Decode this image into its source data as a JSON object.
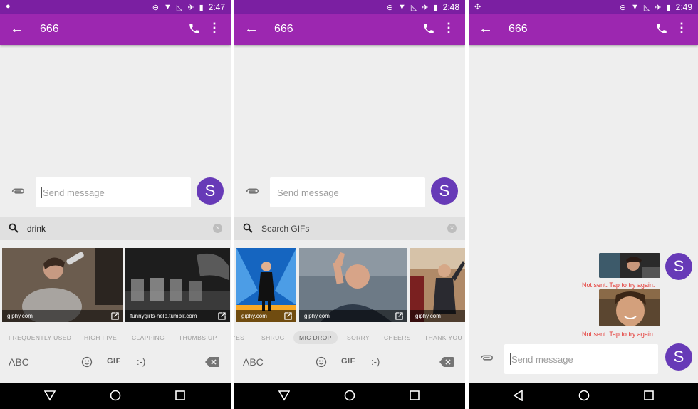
{
  "status": {
    "panel1": {
      "time": "2:47"
    },
    "panel2": {
      "time": "2:48"
    },
    "panel3": {
      "time": "2:49"
    }
  },
  "conversation": {
    "title": "666"
  },
  "compose": {
    "placeholder": "Send message"
  },
  "avatar": {
    "letter": "S",
    "color": "#673ab7"
  },
  "gif_search": {
    "panel1": {
      "query": "drink",
      "placeholder": "Search GIFs"
    },
    "panel2": {
      "query": "",
      "placeholder": "Search GIFs"
    }
  },
  "gifs": {
    "panel1": [
      {
        "source": "giphy.com"
      },
      {
        "source": "funnygirls-help.tumblr.com"
      }
    ],
    "panel2": [
      {
        "source": "giphy.com"
      },
      {
        "source": "giphy.com"
      },
      {
        "source": "giphy.com"
      }
    ]
  },
  "categories": {
    "panel1": [
      "FREQUENTLY USED",
      "HIGH FIVE",
      "CLAPPING",
      "THUMBS UP"
    ],
    "panel2": [
      "YES",
      "SHRUG",
      "MIC DROP",
      "SORRY",
      "CHEERS",
      "THANK YOU"
    ],
    "panel2_selected": "MIC DROP"
  },
  "keyboard": {
    "abc": "ABC",
    "gif": "GIF",
    "emoticon": ":-)"
  },
  "messages": [
    {
      "type": "gif",
      "error": "Not sent. Tap to try again."
    },
    {
      "type": "gif",
      "error": "Not sent. Tap to try again."
    }
  ],
  "colors": {
    "status_bar": "#7b1fa2",
    "app_bar": "#9c27b0",
    "avatar": "#673ab7",
    "error": "#e53935"
  }
}
